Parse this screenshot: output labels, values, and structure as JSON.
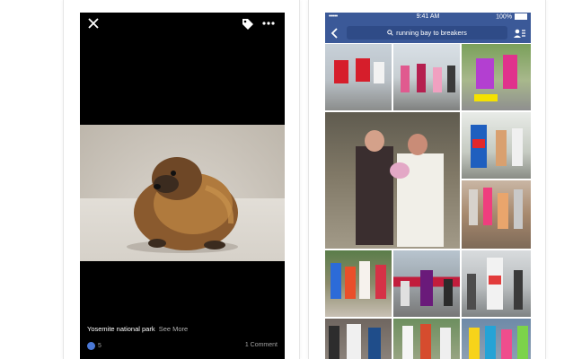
{
  "viewer": {
    "caption_title": "Yosemite national park",
    "caption_more": "See More",
    "likes": "5",
    "comments": "1 Comment",
    "icons": [
      "close-icon",
      "tag-icon",
      "more-icon",
      "like-icon"
    ]
  },
  "search": {
    "carrier": "•••••",
    "time": "9:41 AM",
    "battery": "100%",
    "query": "running bay to breakers",
    "icons": [
      "back-icon",
      "search-icon",
      "profile-icon"
    ],
    "accent": "#3b5998"
  }
}
